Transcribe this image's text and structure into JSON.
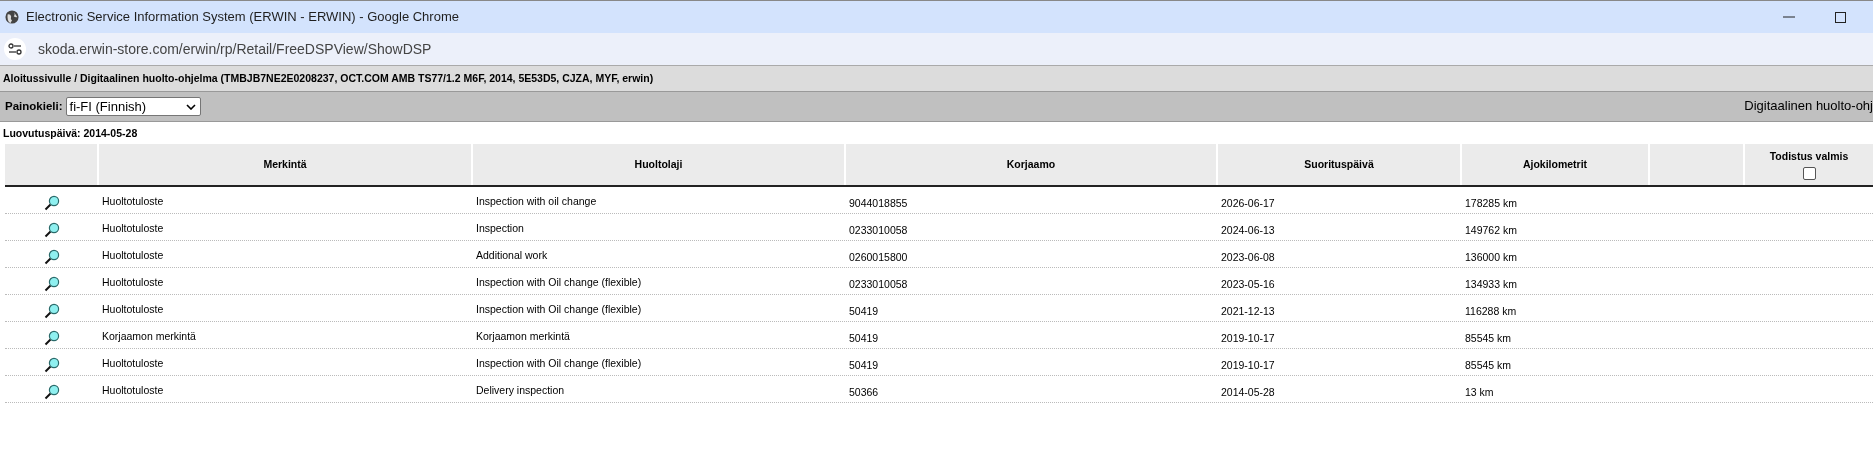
{
  "window": {
    "title": "Electronic Service Information System (ERWIN - ERWIN) - Google Chrome"
  },
  "address_bar": {
    "url": "skoda.erwin-store.com/erwin/rp/Retail/FreeDSPView/ShowDSP"
  },
  "breadcrumb": "Aloitussivulle / Digitaalinen huolto-ohjelma (TMBJB7NE2E0208237, OCT.COM AMB TS77/1.2 M6F, 2014, 5E53D5, CJZA, MYF, erwin)",
  "language_bar": {
    "label": "Painokieli:",
    "value": "fi-FI (Finnish)",
    "page_title": "Digitaalinen huolto-ohj"
  },
  "delivery_date": "Luovutuspäivä: 2014-05-28",
  "table": {
    "columns": [
      "Merkintä",
      "Huoltolaji",
      "Korjaamo",
      "Suorituspäivä",
      "Ajokilometrit"
    ],
    "certificate_column": {
      "label": "Todistus valmis",
      "checked": false
    },
    "rows": [
      {
        "entry": "Huoltotuloste",
        "service": "Inspection with oil change",
        "workshop": "9044018855",
        "date": "2026-06-17",
        "mileage": "178285 km"
      },
      {
        "entry": "Huoltotuloste",
        "service": "Inspection",
        "workshop": "0233010058",
        "date": "2024-06-13",
        "mileage": "149762 km"
      },
      {
        "entry": "Huoltotuloste",
        "service": "Additional work",
        "workshop": "0260015800",
        "date": "2023-06-08",
        "mileage": "136000 km"
      },
      {
        "entry": "Huoltotuloste",
        "service": "Inspection with Oil change (flexible)",
        "workshop": "0233010058",
        "date": "2023-05-16",
        "mileage": "134933 km"
      },
      {
        "entry": "Huoltotuloste",
        "service": "Inspection with Oil change (flexible)",
        "workshop": "50419",
        "date": "2021-12-13",
        "mileage": "116288 km"
      },
      {
        "entry": "Korjaamon merkintä",
        "service": "Korjaamon merkintä",
        "workshop": "50419",
        "date": "2019-10-17",
        "mileage": "85545 km"
      },
      {
        "entry": "Huoltotuloste",
        "service": "Inspection with Oil change (flexible)",
        "workshop": "50419",
        "date": "2019-10-17",
        "mileage": "85545 km"
      },
      {
        "entry": "Huoltotuloste",
        "service": "Delivery inspection",
        "workshop": "50366",
        "date": "2014-05-28",
        "mileage": "13 km"
      }
    ]
  }
}
